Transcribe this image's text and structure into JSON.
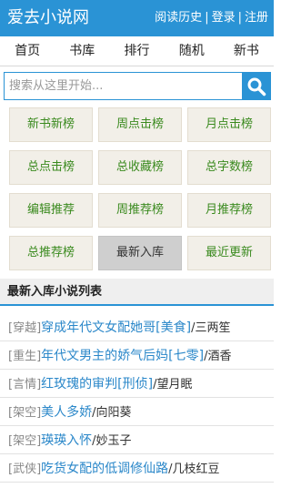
{
  "header": {
    "logo": "爱去小说网",
    "links": [
      "阅读历史",
      "登录",
      "注册"
    ],
    "separator": "|"
  },
  "nav": [
    "首页",
    "书库",
    "排行",
    "随机",
    "新书"
  ],
  "search": {
    "placeholder": "搜索从这里开始...",
    "button_icon": "search-icon"
  },
  "ranking_buttons": [
    "新书新榜",
    "周点击榜",
    "月点击榜",
    "总点击榜",
    "总收藏榜",
    "总字数榜",
    "编辑推荐",
    "周推荐榜",
    "月推荐榜",
    "总推荐榜",
    "最新入库",
    "最近更新"
  ],
  "active_button": "最新入库",
  "section_title": "最新入库小说列表",
  "books": [
    {
      "category": "[穿越]",
      "title": "穿成年代文女配她哥[美食]",
      "author": "三两笙"
    },
    {
      "category": "[重生]",
      "title": "年代文男主的娇气后妈[七零]",
      "author": "酒香"
    },
    {
      "category": "[言情]",
      "title": "红玫瑰的审判[刑侦]",
      "author": "望月眠"
    },
    {
      "category": "[架空]",
      "title": "美人多娇",
      "author": "向阳葵"
    },
    {
      "category": "[架空]",
      "title": "瑛瑛入怀",
      "author": "妙玉子"
    },
    {
      "category": "[武侠]",
      "title": "吃货女配的低调修仙路",
      "author": "几枝红豆"
    }
  ],
  "colors": {
    "brand": "#2a93d5",
    "link": "#2a87c9",
    "button_text": "#3a8a1e",
    "button_bg": "#f2efe8"
  }
}
